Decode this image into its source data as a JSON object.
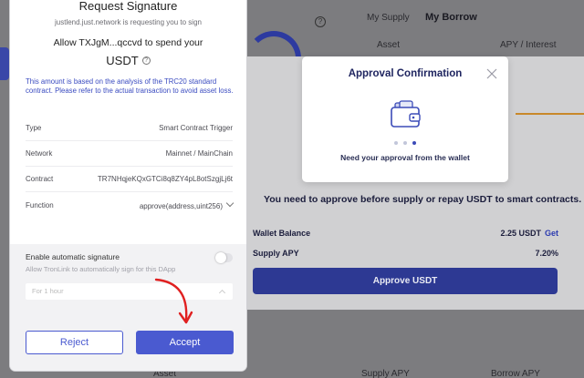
{
  "background": {
    "tabs": {
      "supply": "My Supply",
      "borrow": "My Borrow"
    },
    "columns": {
      "asset": "Asset",
      "apy_interest": "APY / Interest"
    },
    "bottom": {
      "asset": "Asset",
      "supply_apy": "Supply APY",
      "borrow_apy": "Borrow APY"
    },
    "help_glyph": "?"
  },
  "supply_modal": {
    "message": "You need to approve before supply or repay USDT to smart contracts.",
    "wallet_balance_label": "Wallet Balance",
    "wallet_balance_value": "2.25 USDT",
    "get_link": "Get",
    "supply_apy_label": "Supply APY",
    "supply_apy_value": "7.20%",
    "approve_button": "Approve USDT"
  },
  "approval_popup": {
    "title": "Approval Confirmation",
    "message": "Need your approval from the wallet",
    "step_active": 3,
    "step_total": 3
  },
  "sign_request": {
    "title": "Request Signature",
    "origin": "justlend.just.network is requesting you to sign",
    "allow_text": "Allow TXJgM...qccvd to spend your",
    "token": "USDT",
    "help_glyph": "?",
    "note": "This amount is based on the analysis of the TRC20 standard contract. Please refer to the actual transaction to avoid asset loss.",
    "rows": [
      {
        "label": "Type",
        "value": "Smart Contract Trigger"
      },
      {
        "label": "Network",
        "value": "Mainnet / MainChain"
      },
      {
        "label": "Contract",
        "value": "TR7NHqjeKQxGTCi8q8ZY4pL8otSzgjLj6t"
      },
      {
        "label": "Function",
        "value": "approve(address,uint256)"
      }
    ],
    "auto_sign_title": "Enable automatic signature",
    "auto_sign_subtitle": "Allow TronLink to automatically sign for this DApp",
    "auto_sign_enabled": false,
    "duration_placeholder": "For 1 hour",
    "reject_button": "Reject",
    "accept_button": "Accept"
  },
  "colors": {
    "accent": "#4a5ad0",
    "approve_button": "#2d3993",
    "annotation_arrow": "#e02020"
  }
}
